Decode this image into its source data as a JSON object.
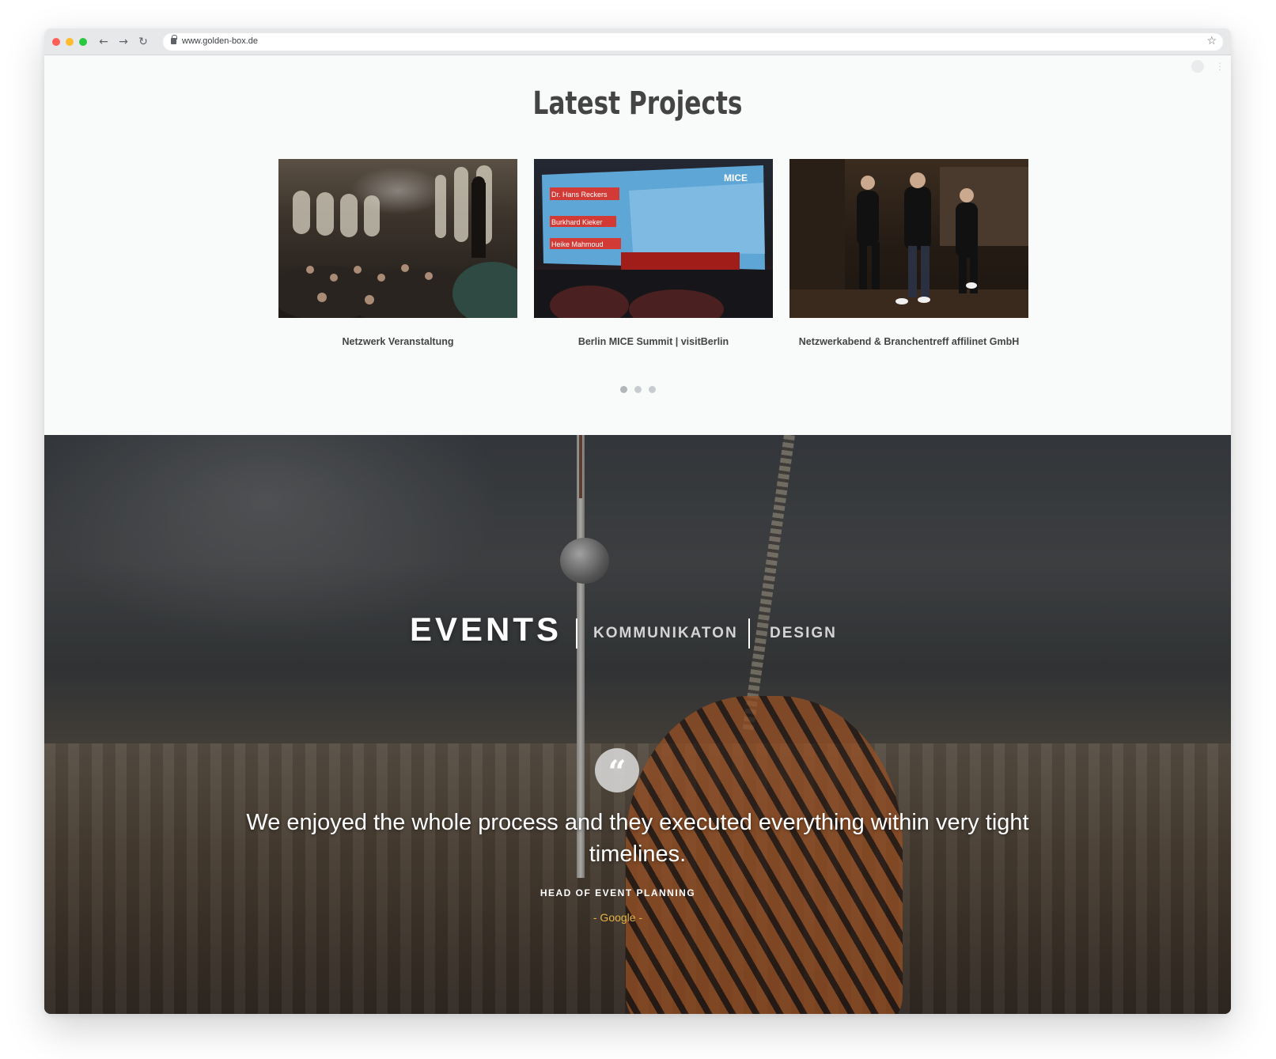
{
  "browser": {
    "url": "www.golden-box.de",
    "back_icon": "arrow-left-icon",
    "forward_icon": "arrow-right-icon",
    "reload_icon": "reload-icon",
    "bookmark_icon": "star-icon"
  },
  "projects": {
    "title": "Latest Projects",
    "items": [
      {
        "caption": "Netzwerk Veranstaltung"
      },
      {
        "caption": "Berlin MICE Summit | visitBerlin"
      },
      {
        "caption": "Netzwerkabend & Branchentreff affilinet GmbH"
      }
    ],
    "slide_screen": {
      "logo": "MICE",
      "names": [
        "Dr. Hans Reckers",
        "Burkhard Kieker",
        "Heike Mahmoud"
      ]
    },
    "pager_count": 3
  },
  "hero": {
    "tag_primary": "EVENTS",
    "tag_second": "KOMMUNIKATON",
    "tag_third": "DESIGN",
    "quote_icon": "quote-icon",
    "quote_mark": "“",
    "quote": "We enjoyed the whole process and they executed everything within very tight timelines.",
    "role": "HEAD OF EVENT PLANNING",
    "company": "- Google -"
  },
  "colors": {
    "accent": "#e8b441",
    "title": "#444444",
    "background": "#f9fafa"
  }
}
